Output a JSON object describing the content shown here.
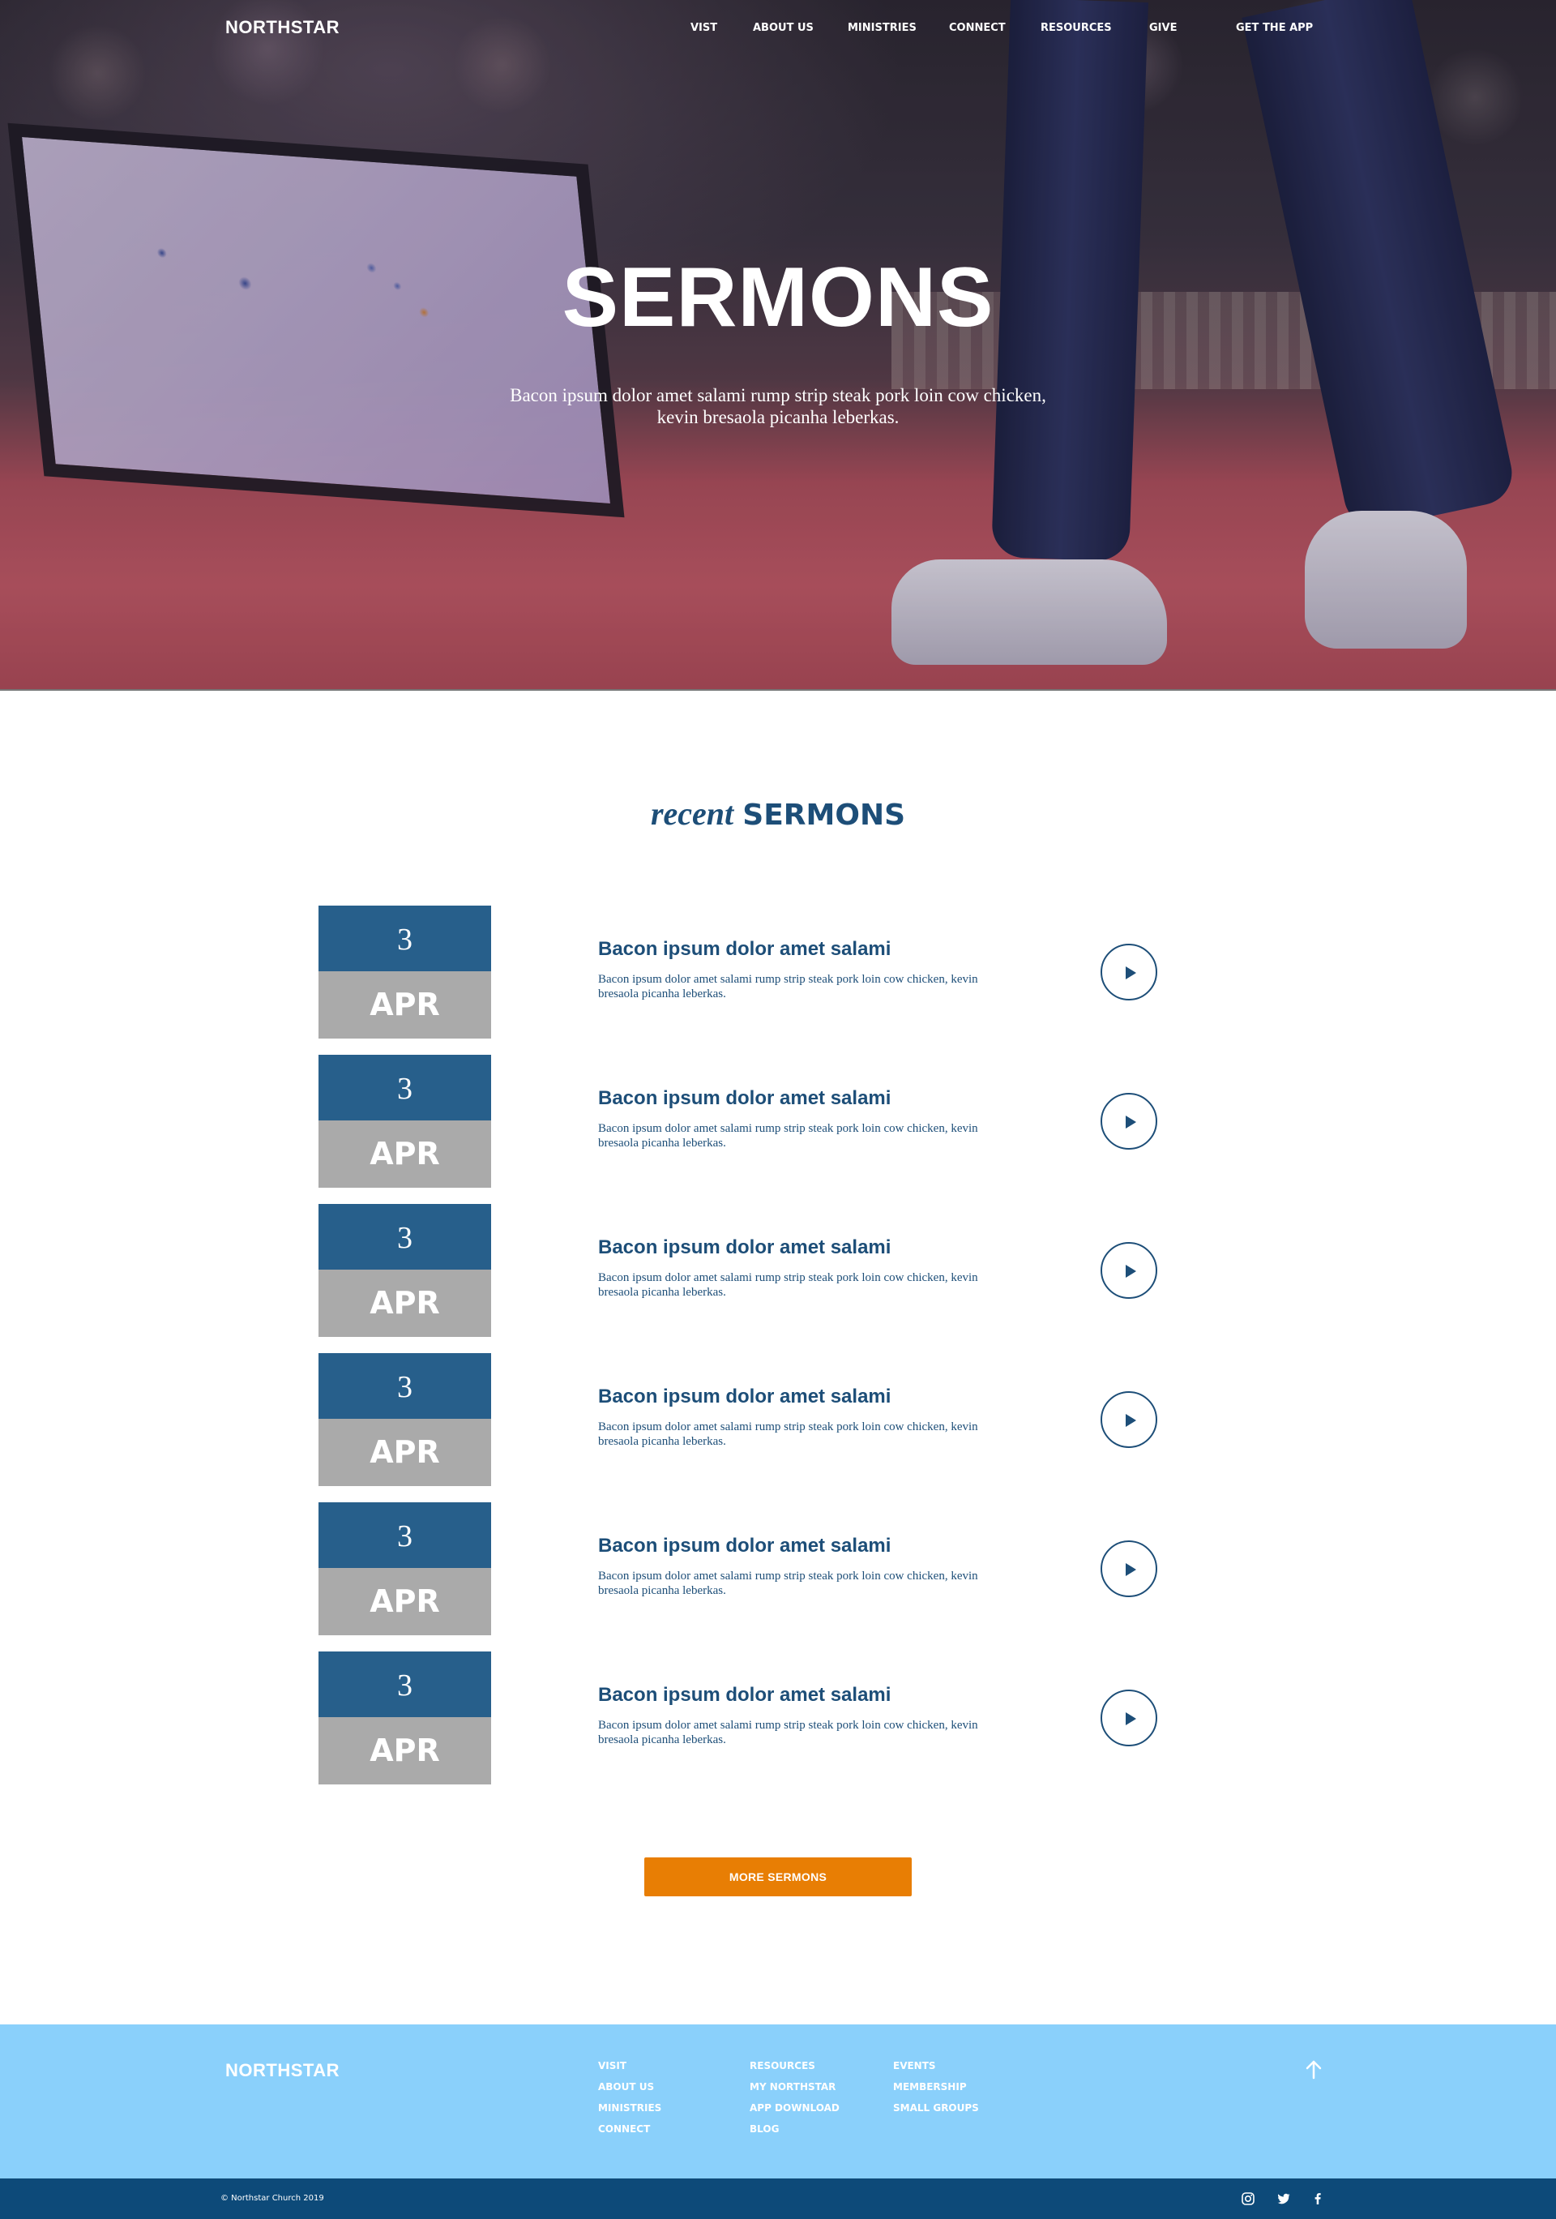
{
  "brand": "NORTHSTAR",
  "nav": {
    "items": [
      "VIST",
      "ABOUT US",
      "MINISTRIES",
      "CONNECT",
      "RESOURCES",
      "GIVE"
    ],
    "cta": "GET THE APP"
  },
  "hero": {
    "title": "SERMONS",
    "subtitle": "Bacon ipsum dolor amet salami rump strip steak pork loin cow chicken, kevin bresaola picanha leberkas."
  },
  "section": {
    "title_italic": "recent",
    "title_bold": "SERMONS"
  },
  "sermons": [
    {
      "day": "3",
      "month": "APR",
      "title": "Bacon ipsum dolor amet salami",
      "description": "Bacon ipsum dolor amet salami rump strip steak pork loin cow chicken, kevin bresaola picanha leberkas."
    },
    {
      "day": "3",
      "month": "APR",
      "title": "Bacon ipsum dolor amet salami",
      "description": "Bacon ipsum dolor amet salami rump strip steak pork loin cow chicken, kevin bresaola picanha leberkas."
    },
    {
      "day": "3",
      "month": "APR",
      "title": "Bacon ipsum dolor amet salami",
      "description": "Bacon ipsum dolor amet salami rump strip steak pork loin cow chicken, kevin bresaola picanha leberkas."
    },
    {
      "day": "3",
      "month": "APR",
      "title": "Bacon ipsum dolor amet salami",
      "description": "Bacon ipsum dolor amet salami rump strip steak pork loin cow chicken, kevin bresaola picanha leberkas."
    },
    {
      "day": "3",
      "month": "APR",
      "title": "Bacon ipsum dolor amet salami",
      "description": "Bacon ipsum dolor amet salami rump strip steak pork loin cow chicken, kevin bresaola picanha leberkas."
    },
    {
      "day": "3",
      "month": "APR",
      "title": "Bacon ipsum dolor amet salami",
      "description": "Bacon ipsum dolor amet salami rump strip steak pork loin cow chicken, kevin bresaola picanha leberkas."
    }
  ],
  "more_button": "MORE SERMONS",
  "footer": {
    "brand": "NORTHSTAR",
    "col1": [
      "VISIT",
      "ABOUT US",
      "MINISTRIES",
      "CONNECT"
    ],
    "col2": [
      "RESOURCES",
      "MY NORTHSTAR",
      "APP DOWNLOAD",
      "BLOG"
    ],
    "col3": [
      "EVENTS",
      "MEMBERSHIP",
      "SMALL GROUPS"
    ],
    "back_to_top_icon": "arrow-up-icon",
    "copyright": "© Northstar Church 2019",
    "social_icons": [
      "instagram-icon",
      "twitter-icon",
      "facebook-icon"
    ]
  },
  "colors": {
    "primary": "#1d4e78",
    "date_blue": "#275f8b",
    "date_gray": "#aaaaaa",
    "accent": "#e87e04",
    "footer_bg": "#8ad0fb",
    "bottom_bar": "#0d4a79"
  }
}
